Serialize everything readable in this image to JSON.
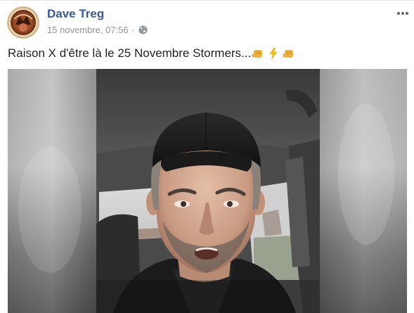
{
  "post": {
    "author": "Dave Treg",
    "timestamp": "15 novembre, 07:56",
    "separator": "·",
    "privacy_icon": "globe-icon",
    "more_icon": "more-dots-icon",
    "text": "Raison X d'être là le 25 Novembre Stormers...",
    "emojis": [
      "fist-icon",
      "lightning-icon",
      "fist-icon"
    ]
  },
  "colors": {
    "author": "#385898",
    "meta": "#90949c",
    "text": "#1d2129",
    "fist": "#f2b43c",
    "lightning": "#f6c21d"
  },
  "video": {
    "subject": "man-in-car-video-frame"
  }
}
